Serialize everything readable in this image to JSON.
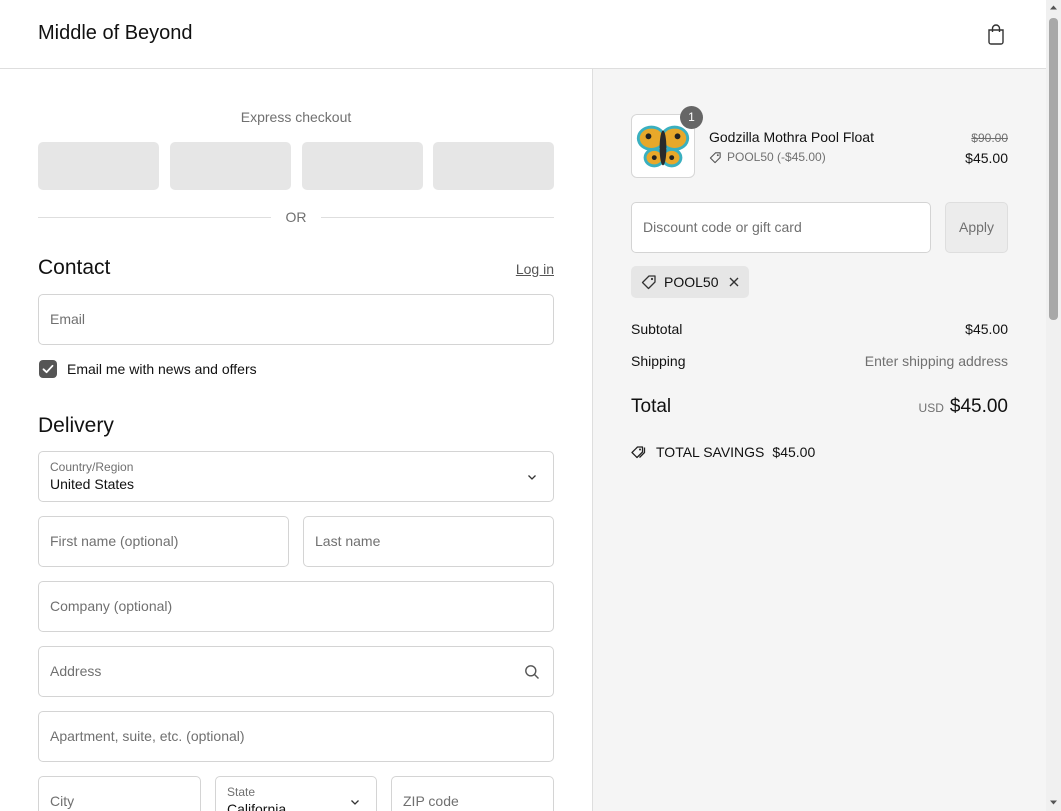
{
  "header": {
    "store_name": "Middle of Beyond",
    "cart_icon": "shopping-bag-icon"
  },
  "express": {
    "title": "Express checkout",
    "or_text": "OR"
  },
  "contact": {
    "title": "Contact",
    "login_label": "Log in",
    "email_placeholder": "Email",
    "newsletter_label": "Email me with news and offers",
    "newsletter_checked": true
  },
  "delivery": {
    "title": "Delivery",
    "country_label": "Country/Region",
    "country_value": "United States",
    "first_name_placeholder": "First name (optional)",
    "last_name_placeholder": "Last name",
    "company_placeholder": "Company (optional)",
    "address_placeholder": "Address",
    "apartment_placeholder": "Apartment, suite, etc. (optional)",
    "city_placeholder": "City",
    "state_label": "State",
    "state_value": "California",
    "zip_placeholder": "ZIP code"
  },
  "summary": {
    "item": {
      "quantity": "1",
      "name": "Godzilla Mothra Pool Float",
      "discount_text": "POOL50 (-$45.00)",
      "original_price": "$90.00",
      "price": "$45.00"
    },
    "discount_placeholder": "Discount code or gift card",
    "apply_label": "Apply",
    "applied_code": "POOL50",
    "subtotal_label": "Subtotal",
    "subtotal_value": "$45.00",
    "shipping_label": "Shipping",
    "shipping_value": "Enter shipping address",
    "total_label": "Total",
    "currency": "USD",
    "total_value": "$45.00",
    "savings_label": "TOTAL SAVINGS",
    "savings_value": "$45.00"
  },
  "colors": {
    "accent": "#555555",
    "sidebar_bg": "#f5f5f5",
    "muted": "#707070"
  }
}
